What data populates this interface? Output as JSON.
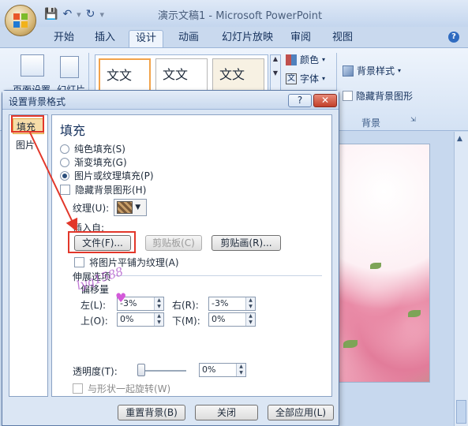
{
  "window": {
    "title": "演示文稿1 - Microsoft PowerPoint"
  },
  "tabs": [
    "开始",
    "插入",
    "设计",
    "动画",
    "幻灯片放映",
    "审阅",
    "视图"
  ],
  "active_tab": "设计",
  "ribbon": {
    "page_setup_label": "页面设置",
    "orientation_label": "幻灯片",
    "theme_sample_text": "文文",
    "colors_label": "颜色",
    "fonts_label": "字体",
    "bg_styles_label": "背景样式",
    "hide_bg_label": "隐藏背景图形",
    "group_background": "背景"
  },
  "dialog": {
    "title": "设置背景格式",
    "help_label": "?",
    "close_label": "✕",
    "nav": [
      "填充",
      "图片"
    ],
    "selected_nav": "填充",
    "panel_title": "填充",
    "fill_options": [
      {
        "label": "纯色填充(S)",
        "selected": false
      },
      {
        "label": "渐变填充(G)",
        "selected": false
      },
      {
        "label": "图片或纹理填充(P)",
        "selected": true
      }
    ],
    "hide_bg_graphics": "隐藏背景图形(H)",
    "texture_label": "纹理(U):",
    "insert_from": "插入自:",
    "file_button": "文件(F)...",
    "clipboard_button": "剪贴板(C)",
    "clipart_button": "剪贴画(R)...",
    "tile_label": "将图片平铺为纹理(A)",
    "stretch_options": "伸展选项",
    "offset_label": "偏移量",
    "left_label": "左(L):",
    "left_value": "-3%",
    "right_label": "右(R):",
    "right_value": "-3%",
    "top_label": "上(O):",
    "top_value": "0%",
    "bottom_label": "下(M):",
    "bottom_value": "0%",
    "transparency_label": "透明度(T):",
    "transparency_value": "0%",
    "transparency_level": 0,
    "rotate_label": "与形状一起旋转(W)",
    "reset_button": "重置背景(B)",
    "close_button": "关闭",
    "apply_all_button": "全部应用(L)",
    "watermark": "lyq1588"
  },
  "colors": {
    "highlight": "#e2372a",
    "selected_nav_bg": "#f6dca8"
  }
}
